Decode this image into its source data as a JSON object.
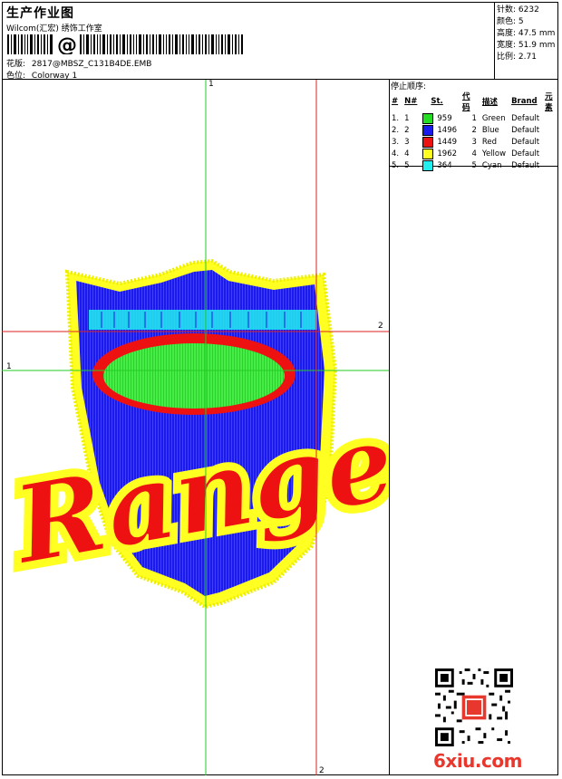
{
  "header": {
    "title": "生产作业图",
    "company": "Wilcom(汇宏) 绣饰工作室",
    "barcode_symbol": "@",
    "design_label": "花版:",
    "design_value": "2817@MBSZ_C131B4DE.EMB",
    "colorway_label": "色位:",
    "colorway_value": "Colorway 1"
  },
  "stats": {
    "stitches_label": "针数:",
    "stitches_value": "6232",
    "colors_label": "颜色:",
    "colors_value": "5",
    "height_label": "高度:",
    "height_value": "47.5 mm",
    "width_label": "宽度:",
    "width_value": "51.9 mm",
    "scale_label": "比例:",
    "scale_value": "2.71"
  },
  "stop_sequence": {
    "heading": "停止顺序:",
    "columns": [
      "#",
      "N#",
      "St.",
      "代码",
      "描述",
      "Brand",
      "元素"
    ],
    "rows": [
      {
        "num": "1.",
        "n": "1",
        "color": "#22dd22",
        "st": "959",
        "code": "1",
        "desc": "Green",
        "brand": "Default"
      },
      {
        "num": "2.",
        "n": "2",
        "color": "#1a1aee",
        "st": "1496",
        "code": "2",
        "desc": "Blue",
        "brand": "Default"
      },
      {
        "num": "3.",
        "n": "3",
        "color": "#ee1111",
        "st": "1449",
        "code": "3",
        "desc": "Red",
        "brand": "Default"
      },
      {
        "num": "4.",
        "n": "4",
        "color": "#ffff22",
        "st": "1962",
        "code": "4",
        "desc": "Yellow",
        "brand": "Default"
      },
      {
        "num": "5.",
        "n": "5",
        "color": "#22eeee",
        "st": "364",
        "code": "5",
        "desc": "Cyan",
        "brand": "Default"
      }
    ]
  },
  "guides": {
    "green_top": "1",
    "green_left": "1",
    "red_right": "2",
    "red_bottom": "2"
  },
  "design": {
    "logo_text": "Rangers"
  },
  "footer": {
    "site": "6xiu.com"
  },
  "colors": {
    "green_guide": "#22cc22",
    "red_guide": "#dd2222",
    "shield_blue": "#1a1aee",
    "thread_yellow": "#ffff22",
    "thread_red": "#ee1111",
    "thread_green": "#44ee44",
    "thread_cyan": "#22eeee",
    "site_red": "#e8382e"
  }
}
